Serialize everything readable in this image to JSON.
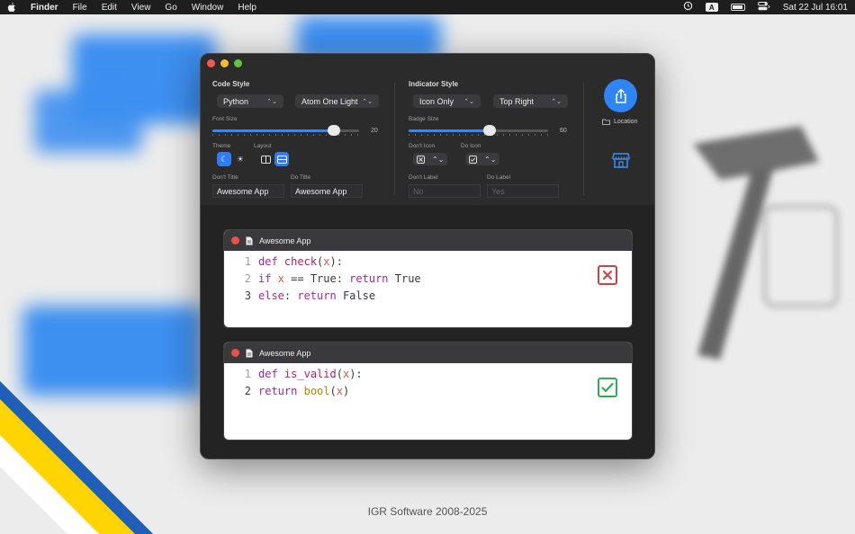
{
  "menubar": {
    "app": "Finder",
    "items": [
      "File",
      "Edit",
      "View",
      "Go",
      "Window",
      "Help"
    ],
    "input_badge": "A",
    "clock": "Sat 22 Jul  16:01"
  },
  "code_style": {
    "title": "Code Style",
    "language": "Python",
    "theme_name": "Atom One Light",
    "font_size_label": "Font Size",
    "font_size": "20",
    "font_size_fraction": 0.83,
    "theme_label": "Theme",
    "layout_label": "Layout",
    "dont_title_label": "Don't Title",
    "dont_title_value": "Awesome App",
    "do_title_label": "Do Title",
    "do_title_value": "Awesome App"
  },
  "indicator_style": {
    "title": "Indicator Style",
    "mode": "Icon Only",
    "position": "Top Right",
    "badge_size_label": "Badge Size",
    "badge_size": "60",
    "badge_size_fraction": 0.58,
    "dont_icon_label": "Don't Icon",
    "do_icon_label": "Do Icon",
    "dont_label_label": "Don't Label",
    "dont_label_placeholder": "No",
    "do_label_label": "Do Label",
    "do_label_placeholder": "Yes"
  },
  "actions": {
    "location_label": "Location"
  },
  "preview_bad": {
    "title": "Awesome App",
    "line_numbers": [
      "1",
      "2",
      "3"
    ]
  },
  "preview_good": {
    "title": "Awesome App",
    "line_numbers": [
      "1",
      "2"
    ]
  },
  "footer": "IGR Software 2008-2025",
  "colors": {
    "accent": "#2f84f7",
    "bad": "#d0413f",
    "good": "#2daf57"
  }
}
